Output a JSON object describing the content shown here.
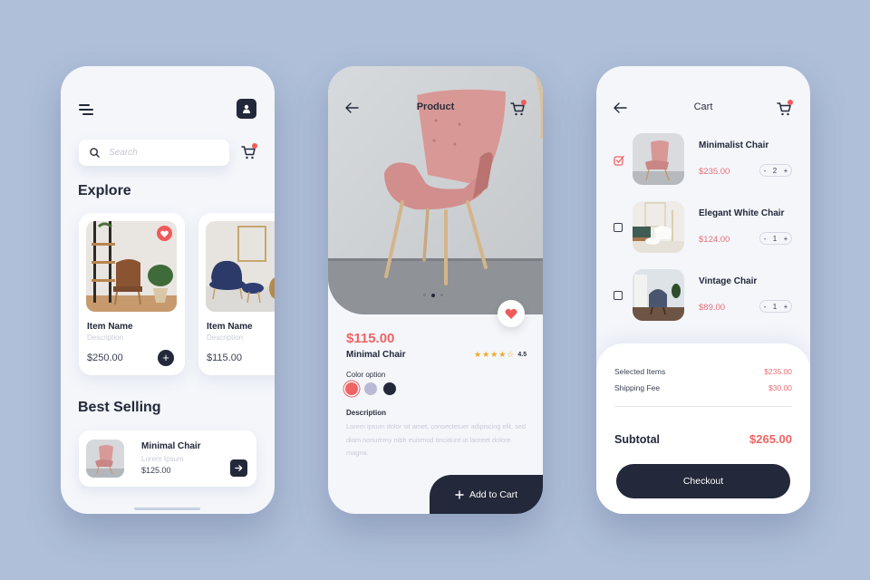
{
  "colors": {
    "background": "#afbfd9",
    "dark": "#23283a",
    "accent": "#ef6464",
    "price_pink": "#e86f78",
    "rating_star": "#f5a623"
  },
  "explore_screen": {
    "search": {
      "placeholder": "Search",
      "icon": "search-icon"
    },
    "menu_icon": "menu-icon",
    "profile_icon": "user-icon",
    "cart_icon": "cart-icon",
    "explore_heading": "Explore",
    "items": [
      {
        "name": "Item Name",
        "description": "Description",
        "price": "$250.00",
        "favorite": true,
        "add_label": "+"
      },
      {
        "name": "Item Name",
        "description": "Description",
        "price": "$115.00"
      }
    ],
    "best_selling_heading": "Best Selling",
    "best_selling": {
      "title": "Minimal Chair",
      "subtitle": "Lorem Ipsum",
      "price": "$125.00"
    }
  },
  "product_screen": {
    "title": "Product",
    "price": "$115.00",
    "name": "Minimal Chair",
    "rating": {
      "stars_filled": 4,
      "stars_total": 5,
      "value": "4.5"
    },
    "color_option_label": "Color option",
    "color_options": [
      {
        "color": "#ef6464",
        "selected": true
      },
      {
        "color": "#b9bad3",
        "selected": false
      },
      {
        "color": "#23283a",
        "selected": false
      }
    ],
    "image_carousel": {
      "count": 3,
      "active_index": 1
    },
    "description_label": "Description",
    "description": "Lorem ipsum dolor sit amet, consectetuer adipiscing elit, sed diam nonummy nibh euismod tincidunt ut laoreet dolore magna.",
    "add_to_cart_label": "Add to Cart"
  },
  "cart_screen": {
    "title": "Cart",
    "items": [
      {
        "name": "Minimalist Chair",
        "price": "$235.00",
        "quantity": "2",
        "checked": true
      },
      {
        "name": "Elegant White Chair",
        "price": "$124.00",
        "quantity": "1",
        "checked": false
      },
      {
        "name": "Vintage Chair",
        "price": "$89.00",
        "quantity": "1",
        "checked": false
      }
    ],
    "summary": {
      "selected_items_label": "Selected Items",
      "selected_items_value": "$235.00",
      "shipping_fee_label": "Shipping Fee",
      "shipping_fee_value": "$30.00",
      "subtotal_label": "Subtotal",
      "subtotal_value": "$265.00"
    },
    "checkout_label": "Checkout",
    "stepper_minus": "-",
    "stepper_plus": "+"
  }
}
